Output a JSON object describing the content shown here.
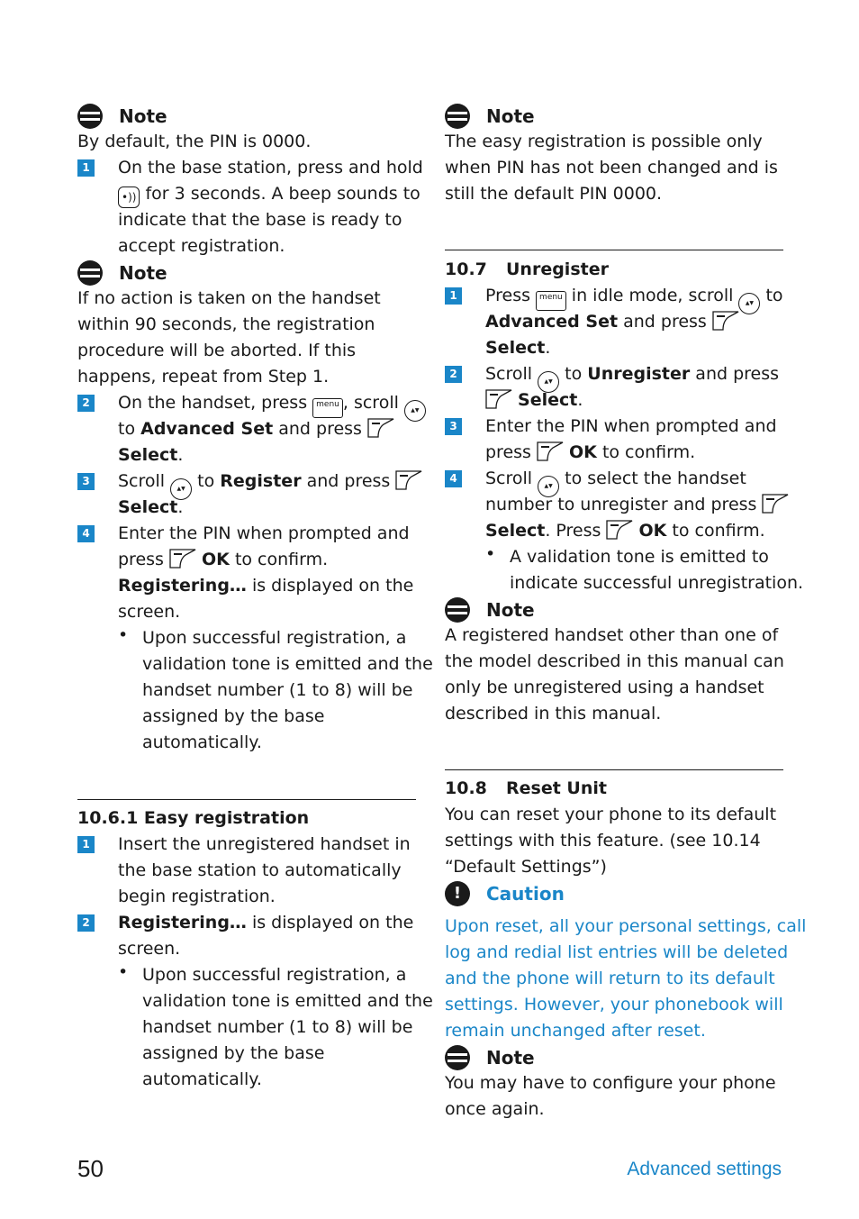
{
  "page": {
    "number": "50",
    "section": "Advanced settings"
  },
  "left": {
    "note1": {
      "title": "Note",
      "text": "By default, the PIN is 0000."
    },
    "step1": {
      "num": "1",
      "a": "On the base station, press and hold",
      "b1": " for 3 seconds. A beep sounds to",
      "c": "indicate that the base is ready to",
      "d": "accept registration."
    },
    "note2": {
      "title": "Note",
      "lines": [
        "If no action is taken on the handset",
        "within 90 seconds, the registration",
        "procedure will be aborted. If this",
        "happens, repeat from Step 1."
      ]
    },
    "step2": {
      "num": "2",
      "a1": "On the handset, press ",
      "a2": ", scroll ",
      "b1": "to ",
      "b2": "Advanced Set",
      "b3": " and press ",
      "c": "Select",
      "c2": "."
    },
    "step3": {
      "num": "3",
      "a1": "Scroll ",
      "a2": " to ",
      "a3": "Register",
      "a4": " and press ",
      "b": "Select",
      "b2": "."
    },
    "step4": {
      "num": "4",
      "a": "Enter the PIN when prompted and",
      "b1": "press ",
      "b2": "OK",
      "b3": " to confirm.",
      "c1": "Registering…",
      "c2": " is displayed on the",
      "d": "screen."
    },
    "bullet1": {
      "lines": [
        "Upon successful registration, a",
        "validation tone is emitted and the",
        "handset number (1 to 8) will be",
        "assigned by the base",
        "automatically."
      ]
    },
    "easy": {
      "heading": "10.6.1 Easy registration",
      "step1": {
        "num": "1",
        "lines": [
          "Insert the unregistered handset in",
          "the base station to automatically",
          "begin registration."
        ]
      },
      "step2": {
        "num": "2",
        "a1": "Registering…",
        "a2": " is displayed on the",
        "b": "screen."
      },
      "bullet": {
        "lines": [
          "Upon successful registration, a",
          "validation tone is emitted and the",
          "handset number (1 to 8) will be",
          "assigned by the base",
          "automatically."
        ]
      }
    }
  },
  "right": {
    "note1": {
      "title": "Note",
      "lines": [
        "The easy registration is possible only",
        "when PIN has not been changed and is",
        "still the default PIN 0000."
      ]
    },
    "unregister": {
      "num": "10.7",
      "title": "Unregister",
      "step1": {
        "num": "1",
        "a1": "Press ",
        "a2": " in idle mode, scroll ",
        "a3": " to",
        "b1": "Advanced Set",
        "b2": " and press ",
        "c": "Select",
        "c2": "."
      },
      "step2": {
        "num": "2",
        "a1": "Scroll ",
        "a2": " to ",
        "a3": "Unregister",
        "a4": " and press",
        "b": "Select",
        "b2": "."
      },
      "step3": {
        "num": "3",
        "a": "Enter the PIN when prompted and",
        "b1": "press ",
        "b2": "OK",
        "b3": " to confirm."
      },
      "step4": {
        "num": "4",
        "a1": "Scroll ",
        "a2": " to select the handset",
        "b": "number to unregister and press ",
        "c1": "Select",
        "c2": ". Press ",
        "c3": "OK",
        "c4": " to confirm."
      },
      "bullet": {
        "lines": [
          "A validation tone is emitted to",
          "indicate successful unregistration."
        ]
      },
      "note": {
        "title": "Note",
        "lines": [
          "A registered handset other than one of",
          "the model described in this manual can",
          "only be unregistered using a handset",
          "described in this manual."
        ]
      }
    },
    "reset": {
      "num": "10.8",
      "title": "Reset Unit",
      "lines": [
        "You can reset your phone to its default",
        "settings with this feature. (see 10.14",
        "“Default Settings”)"
      ],
      "caution": {
        "title": "Caution",
        "lines": [
          "Upon reset, all your personal settings, call",
          "log and redial list entries will be deleted",
          "and the phone will return to its default",
          "settings. However, your phonebook will",
          "remain unchanged after reset."
        ]
      },
      "note": {
        "title": "Note",
        "lines": [
          "You may have to configure your phone",
          "once again."
        ]
      }
    }
  },
  "icons": {
    "menu_key": "menu",
    "nav_key": "call ID Ph.Book",
    "paging_key": "•))"
  },
  "colors": {
    "accent": "#1a86c8",
    "text": "#1a1a1a"
  }
}
